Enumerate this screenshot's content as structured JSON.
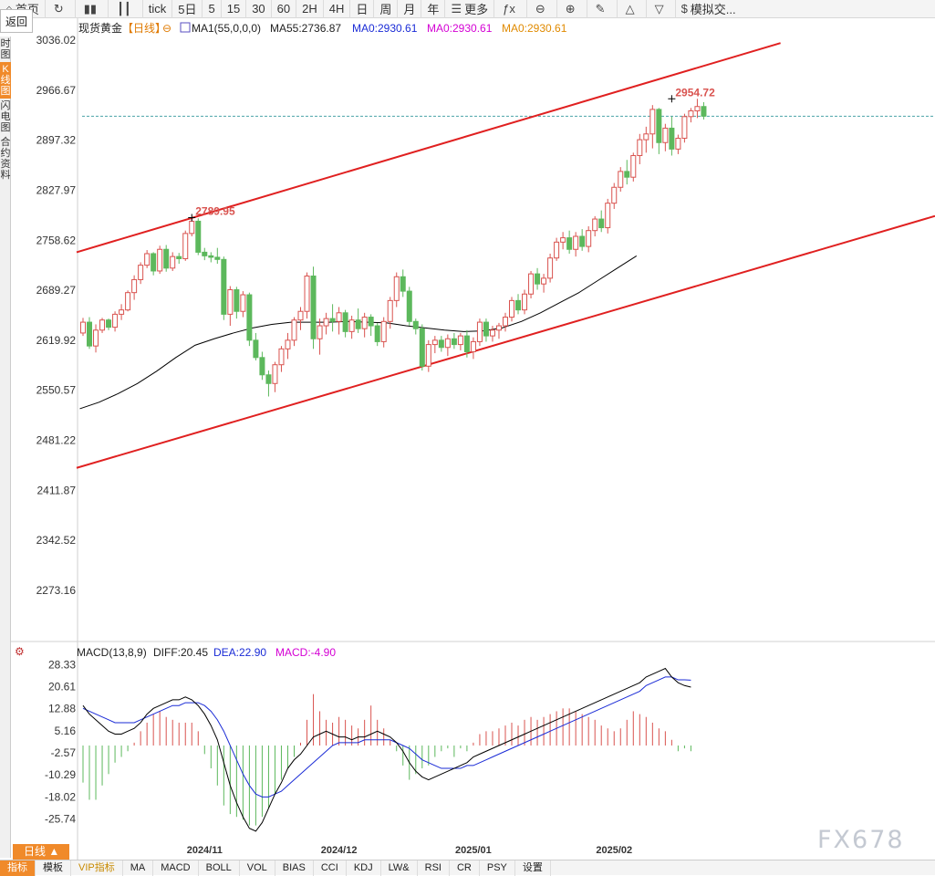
{
  "toolbar": {
    "items": [
      {
        "icon": "home-icon",
        "label": "首页"
      },
      {
        "icon": "refresh-icon",
        "label": ""
      },
      {
        "icon": "bar-chart-icon",
        "label": ""
      },
      {
        "icon": "candlestick-icon",
        "label": ""
      },
      {
        "icon": "",
        "label": "tick"
      },
      {
        "icon": "",
        "label": "5日"
      },
      {
        "icon": "",
        "label": "5"
      },
      {
        "icon": "",
        "label": "15"
      },
      {
        "icon": "",
        "label": "30"
      },
      {
        "icon": "",
        "label": "60"
      },
      {
        "icon": "",
        "label": "2H"
      },
      {
        "icon": "",
        "label": "4H"
      },
      {
        "icon": "",
        "label": "日"
      },
      {
        "icon": "",
        "label": "周"
      },
      {
        "icon": "",
        "label": "月"
      },
      {
        "icon": "",
        "label": "年"
      },
      {
        "icon": "menu-icon",
        "label": "更多"
      },
      {
        "icon": "formula-icon",
        "label": ""
      },
      {
        "icon": "zoom-out-icon",
        "label": ""
      },
      {
        "icon": "zoom-in-icon",
        "label": ""
      },
      {
        "icon": "pen-icon",
        "label": ""
      },
      {
        "icon": "triangle-up-icon",
        "label": ""
      },
      {
        "icon": "triangle-down-icon",
        "label": ""
      },
      {
        "icon": "dollar-icon",
        "label": "模拟交..."
      }
    ]
  },
  "back_button": "返回",
  "sidebar": [
    {
      "label": "时图",
      "active": false
    },
    {
      "label": "K线图",
      "active": true
    },
    {
      "label": "闪电图",
      "active": false
    },
    {
      "label": "合约资料",
      "active": false
    }
  ],
  "header": {
    "instrument": "现货黄金",
    "period": "【日线】",
    "lock_symbol": "⊖",
    "ma_box_label": "MA1(55,0,0,0)",
    "ma55": "MA55:2736.87",
    "ma0_a": "MA0:2930.61",
    "ma0_b": "MA0:2930.61",
    "ma0_c": "MA0:2930.61"
  },
  "macd_header": {
    "label": "MACD(13,8,9)",
    "diff": "DIFF:20.45",
    "dea": "DEA:22.90",
    "macd": "MACD:-4.90"
  },
  "colors": {
    "up": "#d9534f",
    "down": "#5cb85c",
    "channel": "#e02020",
    "ma55": "#000000",
    "dea": "#1a2bd6",
    "diff": "#000000",
    "macd_label": "#d400d4",
    "ma0_a": "#1a2bd6",
    "ma0_b": "#d400d4",
    "ma0_c": "#e08a00",
    "accent": "#f08a2a"
  },
  "period_tab": "日线 ▲",
  "bottom_tabs": [
    "指标",
    "模板",
    "VIP指标",
    "MA",
    "MACD",
    "BOLL",
    "VOL",
    "BIAS",
    "CCI",
    "KDJ",
    "LW&",
    "RSI",
    "CR",
    "PSY",
    "设置"
  ],
  "watermark": "FX678",
  "chart_data": {
    "type": "candlestick",
    "price_axis": {
      "ticks": [
        3036.02,
        2966.67,
        2897.32,
        2827.97,
        2758.62,
        2689.27,
        2619.92,
        2550.57,
        2481.22,
        2411.87,
        2342.52,
        2273.16
      ],
      "ylim": [
        2273.16,
        3036.02
      ]
    },
    "macd_axis": {
      "ticks": [
        28.33,
        20.61,
        12.88,
        5.16,
        -2.57,
        -10.29,
        -18.02,
        -25.74
      ],
      "ylim": [
        -31,
        31
      ]
    },
    "x_tick_labels": [
      {
        "label": "2024/11",
        "index": 19
      },
      {
        "label": "2024/12",
        "index": 40
      },
      {
        "label": "2025/01",
        "index": 61
      },
      {
        "label": "2025/02",
        "index": 83
      }
    ],
    "last_price_line": 2930.61,
    "annotations": [
      {
        "index": 17,
        "text": "2789.95",
        "value": 2789.95
      },
      {
        "index": 92,
        "text": "2954.72",
        "value": 2954.72
      }
    ],
    "channel_lines": [
      {
        "p0": [
          -1,
          2742
        ],
        "p1": [
          109,
          3032
        ]
      },
      {
        "p0": [
          -1,
          2443
        ],
        "p1": [
          135,
          2797
        ]
      }
    ],
    "candles": [
      [
        2630,
        2651,
        2626,
        2645
      ],
      [
        2645,
        2652,
        2608,
        2612
      ],
      [
        2612,
        2642,
        2603,
        2634
      ],
      [
        2634,
        2651,
        2630,
        2648
      ],
      [
        2648,
        2650,
        2634,
        2638
      ],
      [
        2638,
        2660,
        2632,
        2656
      ],
      [
        2656,
        2670,
        2648,
        2662
      ],
      [
        2662,
        2689,
        2660,
        2686
      ],
      [
        2686,
        2710,
        2676,
        2704
      ],
      [
        2704,
        2728,
        2698,
        2724
      ],
      [
        2724,
        2745,
        2720,
        2740
      ],
      [
        2740,
        2742,
        2710,
        2716
      ],
      [
        2716,
        2751,
        2712,
        2746
      ],
      [
        2746,
        2752,
        2715,
        2720
      ],
      [
        2720,
        2742,
        2716,
        2736
      ],
      [
        2736,
        2741,
        2726,
        2733
      ],
      [
        2733,
        2772,
        2730,
        2768
      ],
      [
        2768,
        2790,
        2764,
        2785
      ],
      [
        2785,
        2789,
        2738,
        2742
      ],
      [
        2742,
        2748,
        2731,
        2737
      ],
      [
        2737,
        2742,
        2728,
        2735
      ],
      [
        2735,
        2748,
        2726,
        2732
      ],
      [
        2732,
        2736,
        2648,
        2656
      ],
      [
        2656,
        2695,
        2640,
        2690
      ],
      [
        2690,
        2694,
        2650,
        2660
      ],
      [
        2660,
        2688,
        2652,
        2683
      ],
      [
        2683,
        2686,
        2612,
        2620
      ],
      [
        2620,
        2630,
        2592,
        2596
      ],
      [
        2596,
        2604,
        2565,
        2572
      ],
      [
        2572,
        2578,
        2542,
        2560
      ],
      [
        2560,
        2590,
        2548,
        2586
      ],
      [
        2586,
        2612,
        2576,
        2608
      ],
      [
        2608,
        2630,
        2594,
        2620
      ],
      [
        2620,
        2652,
        2612,
        2648
      ],
      [
        2648,
        2666,
        2634,
        2660
      ],
      [
        2660,
        2714,
        2650,
        2709
      ],
      [
        2709,
        2722,
        2608,
        2622
      ],
      [
        2622,
        2650,
        2600,
        2640
      ],
      [
        2640,
        2658,
        2628,
        2650
      ],
      [
        2650,
        2670,
        2632,
        2646
      ],
      [
        2646,
        2666,
        2628,
        2658
      ],
      [
        2658,
        2662,
        2624,
        2632
      ],
      [
        2632,
        2654,
        2622,
        2648
      ],
      [
        2648,
        2664,
        2630,
        2636
      ],
      [
        2636,
        2658,
        2624,
        2652
      ],
      [
        2652,
        2656,
        2626,
        2640
      ],
      [
        2640,
        2644,
        2612,
        2618
      ],
      [
        2618,
        2652,
        2610,
        2646
      ],
      [
        2646,
        2680,
        2636,
        2675
      ],
      [
        2675,
        2714,
        2666,
        2708
      ],
      [
        2708,
        2718,
        2680,
        2688
      ],
      [
        2688,
        2694,
        2640,
        2646
      ],
      [
        2646,
        2650,
        2628,
        2636
      ],
      [
        2636,
        2642,
        2578,
        2584
      ],
      [
        2584,
        2620,
        2576,
        2614
      ],
      [
        2614,
        2626,
        2602,
        2620
      ],
      [
        2620,
        2626,
        2604,
        2610
      ],
      [
        2610,
        2628,
        2598,
        2622
      ],
      [
        2622,
        2630,
        2608,
        2614
      ],
      [
        2614,
        2630,
        2606,
        2626
      ],
      [
        2626,
        2634,
        2596,
        2604
      ],
      [
        2604,
        2624,
        2594,
        2618
      ],
      [
        2618,
        2650,
        2612,
        2645
      ],
      [
        2645,
        2650,
        2618,
        2626
      ],
      [
        2626,
        2640,
        2618,
        2634
      ],
      [
        2634,
        2644,
        2622,
        2640
      ],
      [
        2640,
        2658,
        2632,
        2652
      ],
      [
        2652,
        2680,
        2646,
        2675
      ],
      [
        2675,
        2684,
        2656,
        2662
      ],
      [
        2662,
        2690,
        2656,
        2684
      ],
      [
        2684,
        2716,
        2678,
        2712
      ],
      [
        2712,
        2720,
        2690,
        2698
      ],
      [
        2698,
        2712,
        2686,
        2706
      ],
      [
        2706,
        2740,
        2700,
        2734
      ],
      [
        2734,
        2762,
        2730,
        2756
      ],
      [
        2756,
        2770,
        2746,
        2762
      ],
      [
        2762,
        2772,
        2740,
        2746
      ],
      [
        2746,
        2770,
        2736,
        2764
      ],
      [
        2764,
        2774,
        2744,
        2750
      ],
      [
        2750,
        2778,
        2742,
        2772
      ],
      [
        2772,
        2792,
        2764,
        2788
      ],
      [
        2788,
        2800,
        2770,
        2776
      ],
      [
        2776,
        2816,
        2768,
        2810
      ],
      [
        2810,
        2838,
        2802,
        2832
      ],
      [
        2832,
        2860,
        2826,
        2854
      ],
      [
        2854,
        2870,
        2836,
        2846
      ],
      [
        2846,
        2880,
        2840,
        2876
      ],
      [
        2876,
        2906,
        2864,
        2898
      ],
      [
        2898,
        2916,
        2880,
        2906
      ],
      [
        2906,
        2946,
        2886,
        2940
      ],
      [
        2940,
        2942,
        2878,
        2894
      ],
      [
        2894,
        2920,
        2882,
        2914
      ],
      [
        2914,
        2930,
        2876,
        2885
      ],
      [
        2885,
        2905,
        2878,
        2900
      ],
      [
        2900,
        2934,
        2894,
        2930
      ],
      [
        2930,
        2942,
        2922,
        2938
      ],
      [
        2938,
        2954.72,
        2928,
        2944
      ],
      [
        2944,
        2950,
        2926,
        2930.61
      ]
    ],
    "ma55": [
      [
        0,
        2525
      ],
      [
        6,
        2534
      ],
      [
        12,
        2546
      ],
      [
        18,
        2560
      ],
      [
        24,
        2577
      ],
      [
        30,
        2596
      ],
      [
        36,
        2613
      ],
      [
        42,
        2622
      ],
      [
        48,
        2630
      ],
      [
        54,
        2637
      ],
      [
        60,
        2642
      ],
      [
        66,
        2645
      ],
      [
        72,
        2645
      ],
      [
        78,
        2645
      ],
      [
        84,
        2646
      ],
      [
        90,
        2645
      ],
      [
        96,
        2644
      ],
      [
        102,
        2640
      ],
      [
        108,
        2637
      ],
      [
        114,
        2634
      ],
      [
        120,
        2632
      ],
      [
        126,
        2633
      ],
      [
        132,
        2637
      ],
      [
        138,
        2646
      ],
      [
        144,
        2658
      ],
      [
        150,
        2672
      ],
      [
        156,
        2686
      ],
      [
        162,
        2703
      ],
      [
        168,
        2720
      ],
      [
        174,
        2736.87
      ]
    ],
    "macd_hist": [
      -13,
      -19,
      -19,
      -14,
      -10,
      -6,
      -4,
      -2,
      1,
      5,
      8,
      11,
      12,
      10,
      9,
      8,
      8,
      8,
      5,
      -3,
      -8,
      -14,
      -21,
      -24,
      -25,
      -26,
      -28,
      -28,
      -25,
      -22,
      -17,
      -12,
      -8,
      -4,
      1,
      9,
      18,
      12,
      9,
      8,
      10,
      9,
      7,
      6,
      9,
      14,
      9,
      6,
      2,
      -2,
      -7,
      -12,
      -10,
      -8,
      -7,
      -4,
      -2,
      -1,
      -4,
      -1,
      -2,
      1,
      4,
      5,
      5,
      6,
      7,
      8,
      7,
      9,
      10,
      9,
      10,
      11,
      12,
      13,
      13,
      12,
      11,
      10,
      9,
      7,
      6,
      5,
      6,
      9,
      12,
      11,
      10,
      8,
      6,
      5,
      2,
      -2,
      -1,
      -2
    ],
    "diff": [
      14,
      11,
      9,
      7,
      5,
      4,
      4,
      5,
      6,
      8,
      11,
      13,
      14,
      15,
      16,
      16,
      17,
      16,
      14,
      11,
      7,
      2,
      -6,
      -14,
      -20,
      -25,
      -29,
      -30,
      -27,
      -22,
      -17,
      -13,
      -8,
      -5,
      -3,
      0,
      3,
      4,
      5,
      4,
      3,
      3,
      2,
      3,
      3,
      4,
      5,
      4,
      3,
      1,
      -2,
      -6,
      -9,
      -11,
      -12,
      -11,
      -10,
      -9,
      -8,
      -7,
      -6,
      -4,
      -3,
      -2,
      -1,
      0,
      1,
      2,
      3,
      4,
      5,
      6,
      7,
      8,
      9,
      10,
      11,
      12,
      13,
      14,
      15,
      16,
      17,
      18,
      19,
      20,
      21,
      22,
      24,
      25,
      26,
      27,
      24,
      22,
      21,
      20.45
    ],
    "dea": [
      13,
      12,
      11,
      10,
      9,
      8,
      8,
      8,
      8,
      9,
      10,
      11,
      12,
      13,
      14,
      14,
      15,
      15,
      15,
      14,
      12,
      9,
      5,
      0,
      -5,
      -10,
      -14,
      -17,
      -18,
      -18,
      -17,
      -16,
      -14,
      -12,
      -10,
      -8,
      -6,
      -4,
      -2,
      0,
      1,
      1,
      1,
      1,
      2,
      2,
      2,
      2,
      2,
      1,
      0,
      -1,
      -3,
      -5,
      -6,
      -7,
      -8,
      -8,
      -8,
      -8,
      -7,
      -7,
      -6,
      -5,
      -4,
      -3,
      -2,
      -1,
      0,
      1,
      2,
      3,
      4,
      5,
      6,
      7,
      8,
      9,
      10,
      11,
      12,
      13,
      14,
      15,
      16,
      17,
      18,
      19,
      21,
      22,
      23,
      24,
      24,
      23,
      23,
      22.9
    ]
  }
}
